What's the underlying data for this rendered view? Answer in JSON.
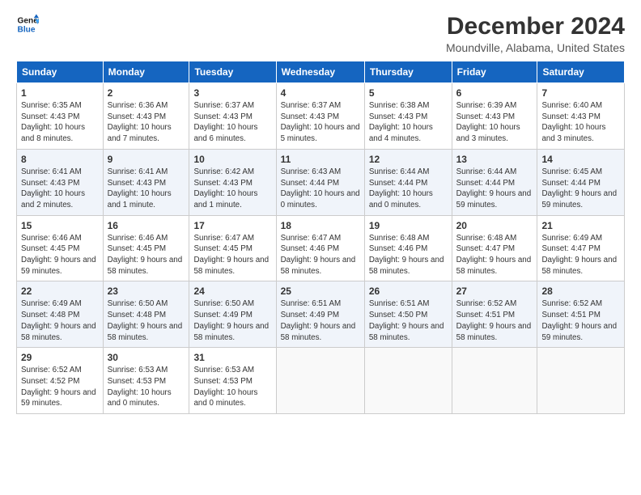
{
  "header": {
    "logo_line1": "General",
    "logo_line2": "Blue",
    "title": "December 2024",
    "subtitle": "Moundville, Alabama, United States"
  },
  "columns": [
    "Sunday",
    "Monday",
    "Tuesday",
    "Wednesday",
    "Thursday",
    "Friday",
    "Saturday"
  ],
  "weeks": [
    [
      {
        "day": "1",
        "sunrise": "Sunrise: 6:35 AM",
        "sunset": "Sunset: 4:43 PM",
        "daylight": "Daylight: 10 hours and 8 minutes."
      },
      {
        "day": "2",
        "sunrise": "Sunrise: 6:36 AM",
        "sunset": "Sunset: 4:43 PM",
        "daylight": "Daylight: 10 hours and 7 minutes."
      },
      {
        "day": "3",
        "sunrise": "Sunrise: 6:37 AM",
        "sunset": "Sunset: 4:43 PM",
        "daylight": "Daylight: 10 hours and 6 minutes."
      },
      {
        "day": "4",
        "sunrise": "Sunrise: 6:37 AM",
        "sunset": "Sunset: 4:43 PM",
        "daylight": "Daylight: 10 hours and 5 minutes."
      },
      {
        "day": "5",
        "sunrise": "Sunrise: 6:38 AM",
        "sunset": "Sunset: 4:43 PM",
        "daylight": "Daylight: 10 hours and 4 minutes."
      },
      {
        "day": "6",
        "sunrise": "Sunrise: 6:39 AM",
        "sunset": "Sunset: 4:43 PM",
        "daylight": "Daylight: 10 hours and 3 minutes."
      },
      {
        "day": "7",
        "sunrise": "Sunrise: 6:40 AM",
        "sunset": "Sunset: 4:43 PM",
        "daylight": "Daylight: 10 hours and 3 minutes."
      }
    ],
    [
      {
        "day": "8",
        "sunrise": "Sunrise: 6:41 AM",
        "sunset": "Sunset: 4:43 PM",
        "daylight": "Daylight: 10 hours and 2 minutes."
      },
      {
        "day": "9",
        "sunrise": "Sunrise: 6:41 AM",
        "sunset": "Sunset: 4:43 PM",
        "daylight": "Daylight: 10 hours and 1 minute."
      },
      {
        "day": "10",
        "sunrise": "Sunrise: 6:42 AM",
        "sunset": "Sunset: 4:43 PM",
        "daylight": "Daylight: 10 hours and 1 minute."
      },
      {
        "day": "11",
        "sunrise": "Sunrise: 6:43 AM",
        "sunset": "Sunset: 4:44 PM",
        "daylight": "Daylight: 10 hours and 0 minutes."
      },
      {
        "day": "12",
        "sunrise": "Sunrise: 6:44 AM",
        "sunset": "Sunset: 4:44 PM",
        "daylight": "Daylight: 10 hours and 0 minutes."
      },
      {
        "day": "13",
        "sunrise": "Sunrise: 6:44 AM",
        "sunset": "Sunset: 4:44 PM",
        "daylight": "Daylight: 9 hours and 59 minutes."
      },
      {
        "day": "14",
        "sunrise": "Sunrise: 6:45 AM",
        "sunset": "Sunset: 4:44 PM",
        "daylight": "Daylight: 9 hours and 59 minutes."
      }
    ],
    [
      {
        "day": "15",
        "sunrise": "Sunrise: 6:46 AM",
        "sunset": "Sunset: 4:45 PM",
        "daylight": "Daylight: 9 hours and 59 minutes."
      },
      {
        "day": "16",
        "sunrise": "Sunrise: 6:46 AM",
        "sunset": "Sunset: 4:45 PM",
        "daylight": "Daylight: 9 hours and 58 minutes."
      },
      {
        "day": "17",
        "sunrise": "Sunrise: 6:47 AM",
        "sunset": "Sunset: 4:45 PM",
        "daylight": "Daylight: 9 hours and 58 minutes."
      },
      {
        "day": "18",
        "sunrise": "Sunrise: 6:47 AM",
        "sunset": "Sunset: 4:46 PM",
        "daylight": "Daylight: 9 hours and 58 minutes."
      },
      {
        "day": "19",
        "sunrise": "Sunrise: 6:48 AM",
        "sunset": "Sunset: 4:46 PM",
        "daylight": "Daylight: 9 hours and 58 minutes."
      },
      {
        "day": "20",
        "sunrise": "Sunrise: 6:48 AM",
        "sunset": "Sunset: 4:47 PM",
        "daylight": "Daylight: 9 hours and 58 minutes."
      },
      {
        "day": "21",
        "sunrise": "Sunrise: 6:49 AM",
        "sunset": "Sunset: 4:47 PM",
        "daylight": "Daylight: 9 hours and 58 minutes."
      }
    ],
    [
      {
        "day": "22",
        "sunrise": "Sunrise: 6:49 AM",
        "sunset": "Sunset: 4:48 PM",
        "daylight": "Daylight: 9 hours and 58 minutes."
      },
      {
        "day": "23",
        "sunrise": "Sunrise: 6:50 AM",
        "sunset": "Sunset: 4:48 PM",
        "daylight": "Daylight: 9 hours and 58 minutes."
      },
      {
        "day": "24",
        "sunrise": "Sunrise: 6:50 AM",
        "sunset": "Sunset: 4:49 PM",
        "daylight": "Daylight: 9 hours and 58 minutes."
      },
      {
        "day": "25",
        "sunrise": "Sunrise: 6:51 AM",
        "sunset": "Sunset: 4:49 PM",
        "daylight": "Daylight: 9 hours and 58 minutes."
      },
      {
        "day": "26",
        "sunrise": "Sunrise: 6:51 AM",
        "sunset": "Sunset: 4:50 PM",
        "daylight": "Daylight: 9 hours and 58 minutes."
      },
      {
        "day": "27",
        "sunrise": "Sunrise: 6:52 AM",
        "sunset": "Sunset: 4:51 PM",
        "daylight": "Daylight: 9 hours and 58 minutes."
      },
      {
        "day": "28",
        "sunrise": "Sunrise: 6:52 AM",
        "sunset": "Sunset: 4:51 PM",
        "daylight": "Daylight: 9 hours and 59 minutes."
      }
    ],
    [
      {
        "day": "29",
        "sunrise": "Sunrise: 6:52 AM",
        "sunset": "Sunset: 4:52 PM",
        "daylight": "Daylight: 9 hours and 59 minutes."
      },
      {
        "day": "30",
        "sunrise": "Sunrise: 6:53 AM",
        "sunset": "Sunset: 4:53 PM",
        "daylight": "Daylight: 10 hours and 0 minutes."
      },
      {
        "day": "31",
        "sunrise": "Sunrise: 6:53 AM",
        "sunset": "Sunset: 4:53 PM",
        "daylight": "Daylight: 10 hours and 0 minutes."
      },
      null,
      null,
      null,
      null
    ]
  ]
}
